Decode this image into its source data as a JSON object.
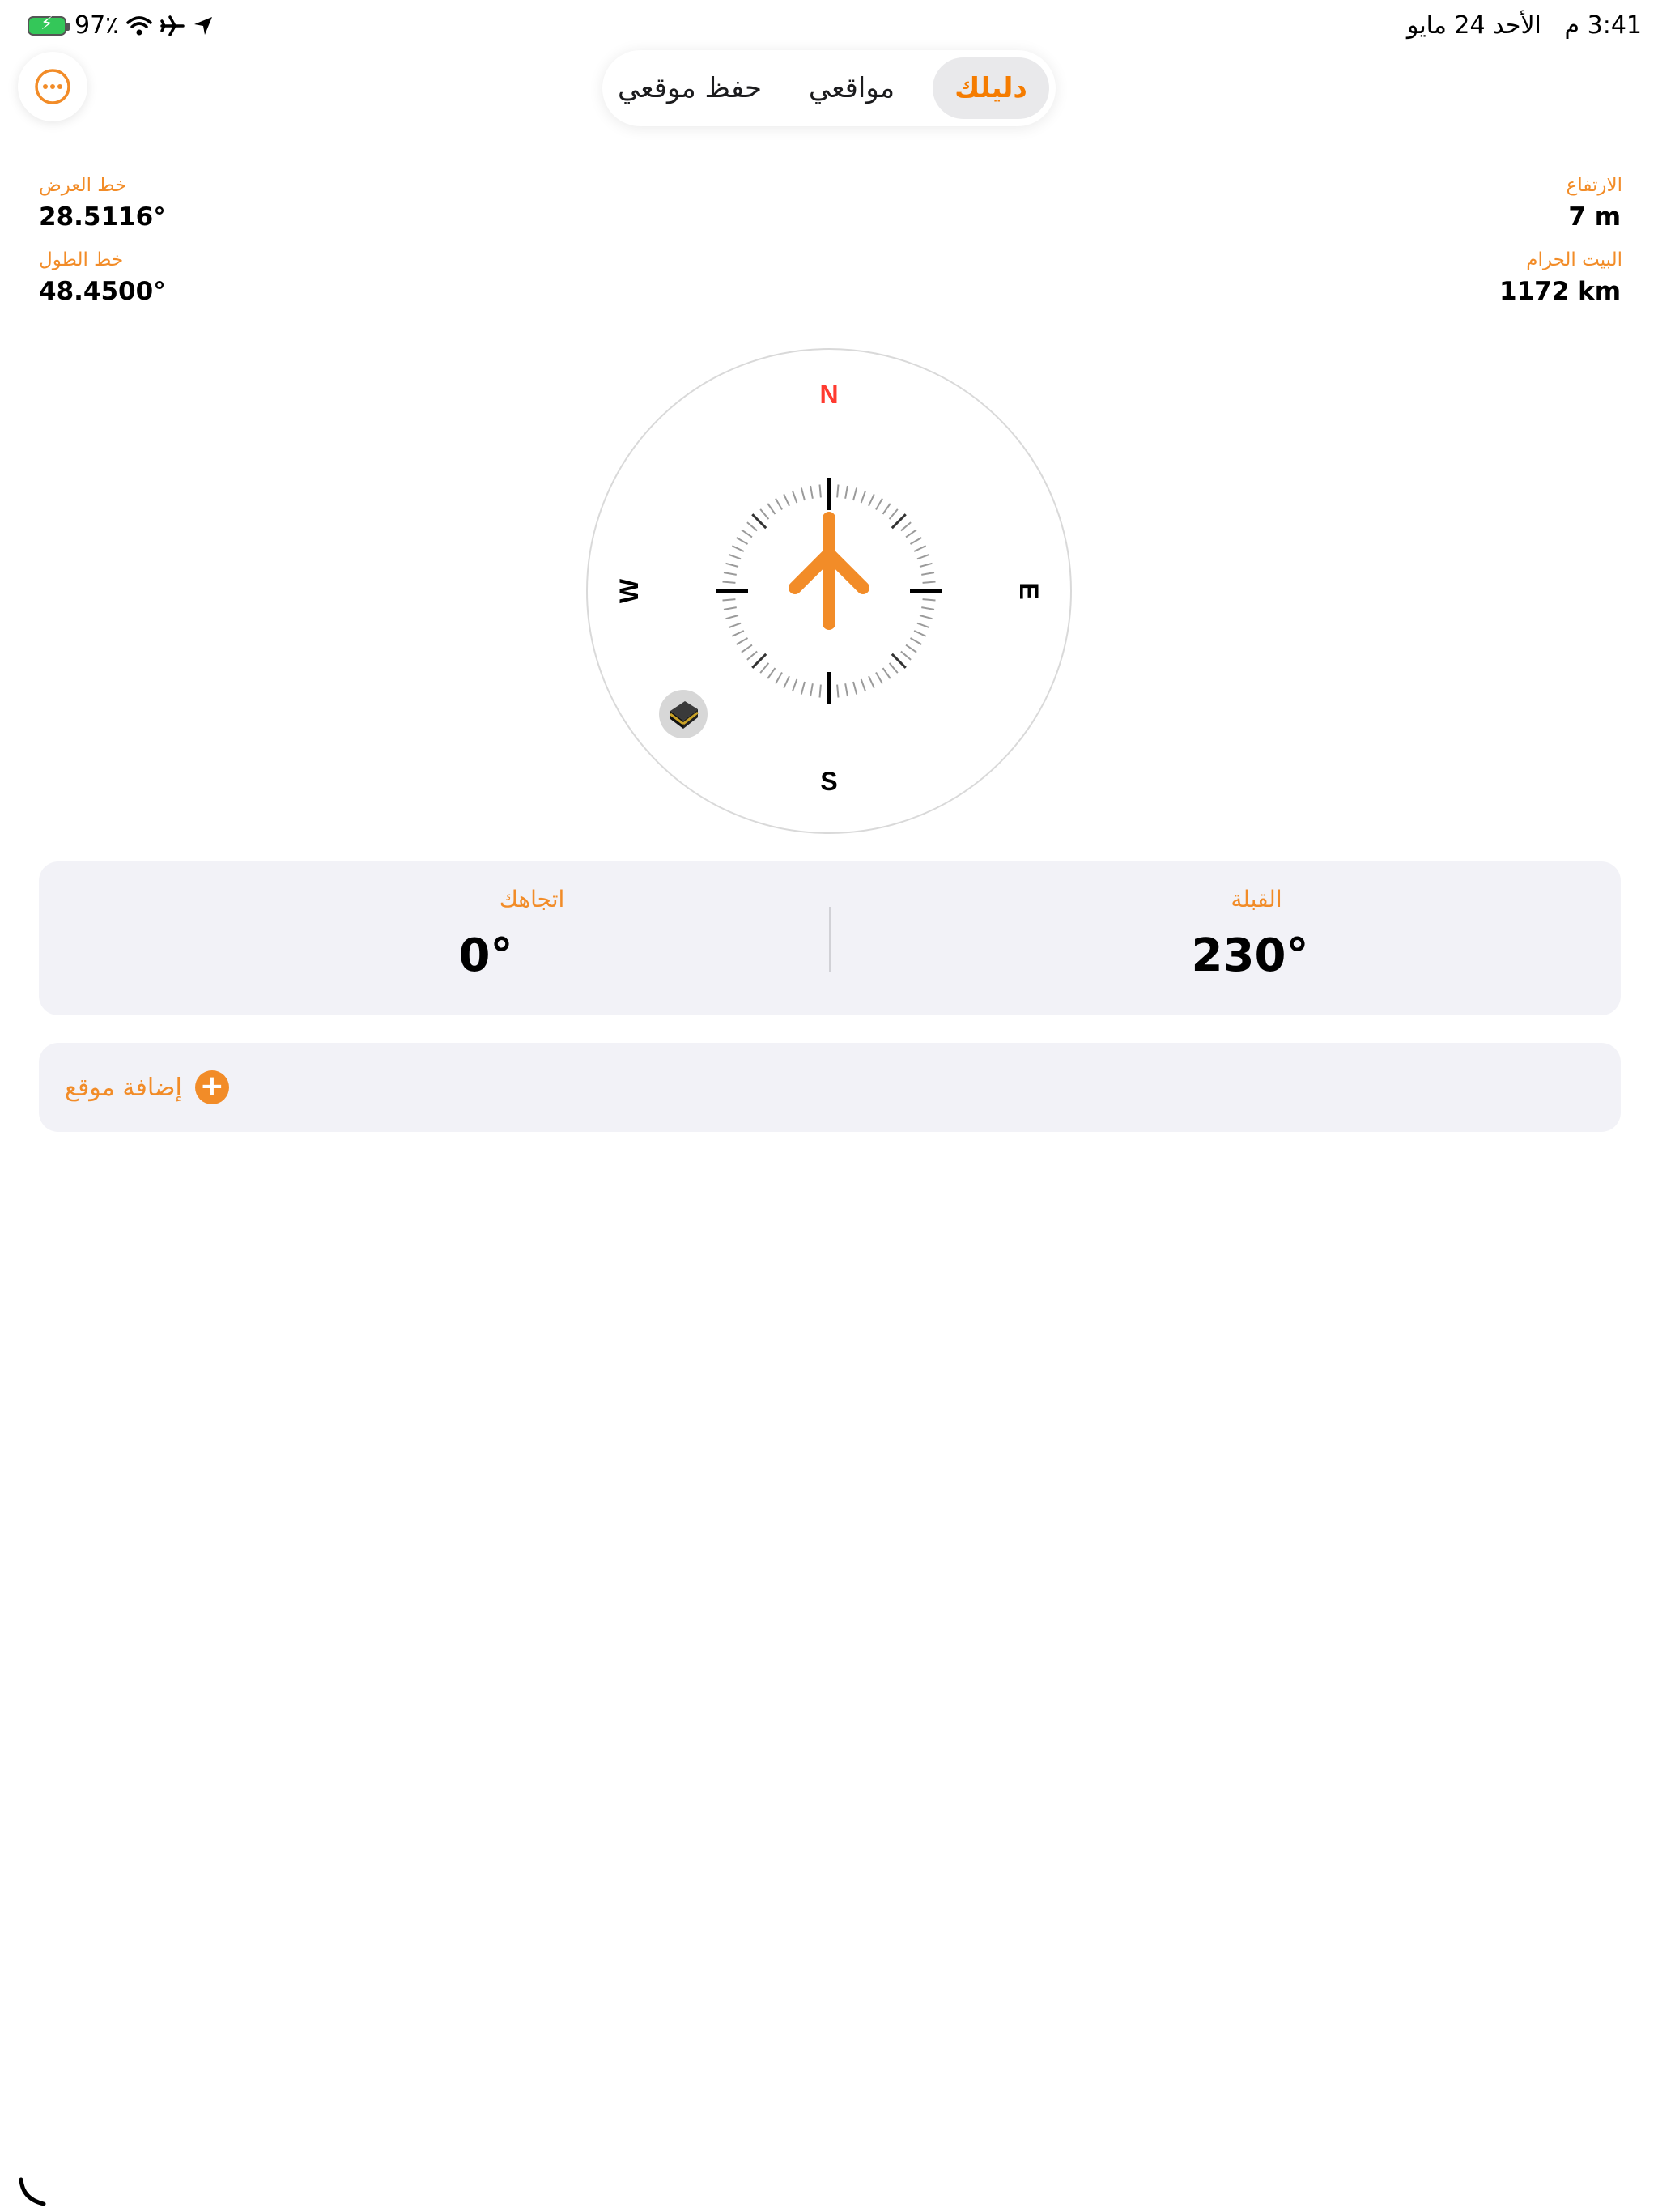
{
  "status_bar": {
    "time": "3:41 م",
    "date": "الأحد 24 مايو",
    "battery": "97٪"
  },
  "segments": {
    "save_location": "حفظ موقعي",
    "my_locations": "مواقعي",
    "guide": "دليلك"
  },
  "info": {
    "latitude_label": "خط العرض",
    "latitude_value": "28.5116°",
    "longitude_label": "خط الطول",
    "longitude_value": "48.4500°",
    "altitude_label": "الارتفاع",
    "altitude_value": "7 m",
    "kaaba_label": "البيت الحرام",
    "kaaba_distance": "1172 km"
  },
  "compass": {
    "north": "N",
    "east": "E",
    "south": "S",
    "west": "W",
    "north_color": "#ff3b30",
    "arrow_color": "#f28c28",
    "heading_deg": 0,
    "qibla_deg": 230
  },
  "headings": {
    "qibla_label": "القبلة",
    "qibla_value": "230°",
    "direction_label": "اتجاهك",
    "direction_value": "0°"
  },
  "add_location": {
    "label": "إضافة موقع"
  },
  "colors": {
    "accent": "#f28c28",
    "card_bg": "#f2f2f7"
  }
}
